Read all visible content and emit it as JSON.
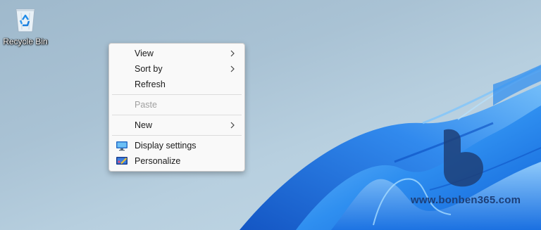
{
  "desktop": {
    "icons": [
      {
        "label": "Recycle Bin",
        "icon": "recycle-bin-icon"
      }
    ]
  },
  "context_menu": {
    "items": [
      {
        "label": "View",
        "submenu": true,
        "enabled": true
      },
      {
        "label": "Sort by",
        "submenu": true,
        "enabled": true
      },
      {
        "label": "Refresh",
        "submenu": false,
        "enabled": true
      },
      {
        "label": "Paste",
        "submenu": false,
        "enabled": false
      },
      {
        "label": "New",
        "submenu": true,
        "enabled": true
      },
      {
        "label": "Display settings",
        "icon": "display-icon",
        "enabled": true
      },
      {
        "label": "Personalize",
        "icon": "personalize-icon",
        "enabled": true
      }
    ]
  },
  "watermark": {
    "text": "www.bonben365.com"
  },
  "colors": {
    "wallpaper_bloom": "#1f7fe6",
    "wallpaper_bloom_light": "#4aa6f5",
    "watermark": "#1d3f78"
  }
}
